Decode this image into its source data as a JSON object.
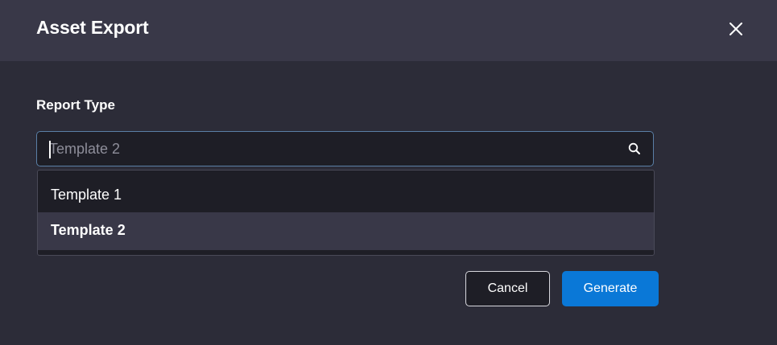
{
  "dialog": {
    "title": "Asset Export",
    "close_icon": "close-icon"
  },
  "report_type": {
    "label": "Report Type",
    "search": {
      "value": "",
      "placeholder": "Template 2",
      "icon": "search-icon"
    },
    "options": [
      {
        "label": "Template 1",
        "selected": false
      },
      {
        "label": "Template 2",
        "selected": true
      }
    ]
  },
  "actions": {
    "cancel_label": "Cancel",
    "generate_label": "Generate"
  },
  "colors": {
    "background": "#2c2c38",
    "header": "#393848",
    "input_bg": "#1e1e26",
    "accent": "#0a78d7",
    "focus_border": "#5a7fa6"
  }
}
